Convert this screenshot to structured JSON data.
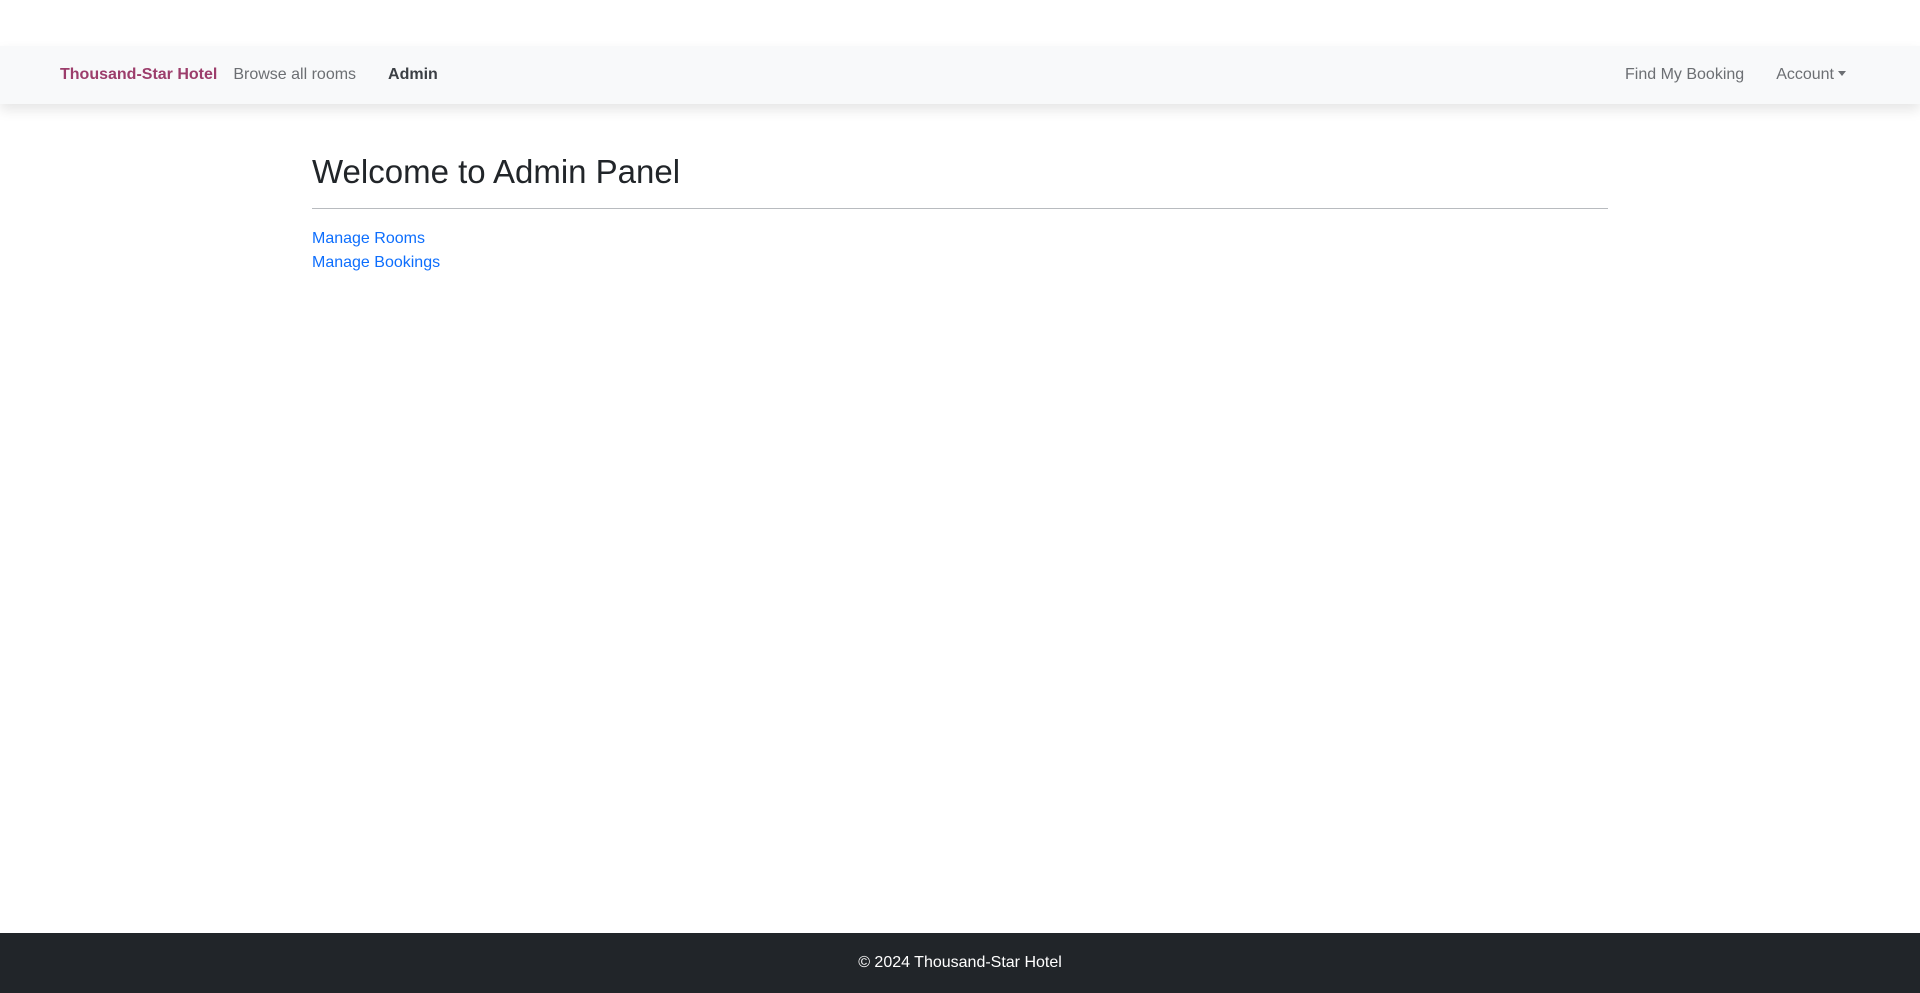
{
  "navbar": {
    "brand": "Thousand-Star Hotel",
    "links": {
      "browse": "Browse all rooms",
      "admin": "Admin",
      "find_booking": "Find My Booking",
      "account": "Account"
    }
  },
  "main": {
    "title": "Welcome to Admin Panel",
    "links": {
      "manage_rooms": "Manage Rooms",
      "manage_bookings": "Manage Bookings"
    }
  },
  "footer": {
    "text": "© 2024 Thousand-Star Hotel"
  },
  "colors": {
    "brand": "#9c3d6b",
    "link": "#0d6efd",
    "navbar_bg": "#f8f9fa",
    "footer_bg": "#212529"
  },
  "icons": {
    "account_dropdown": "caret-down-icon"
  }
}
